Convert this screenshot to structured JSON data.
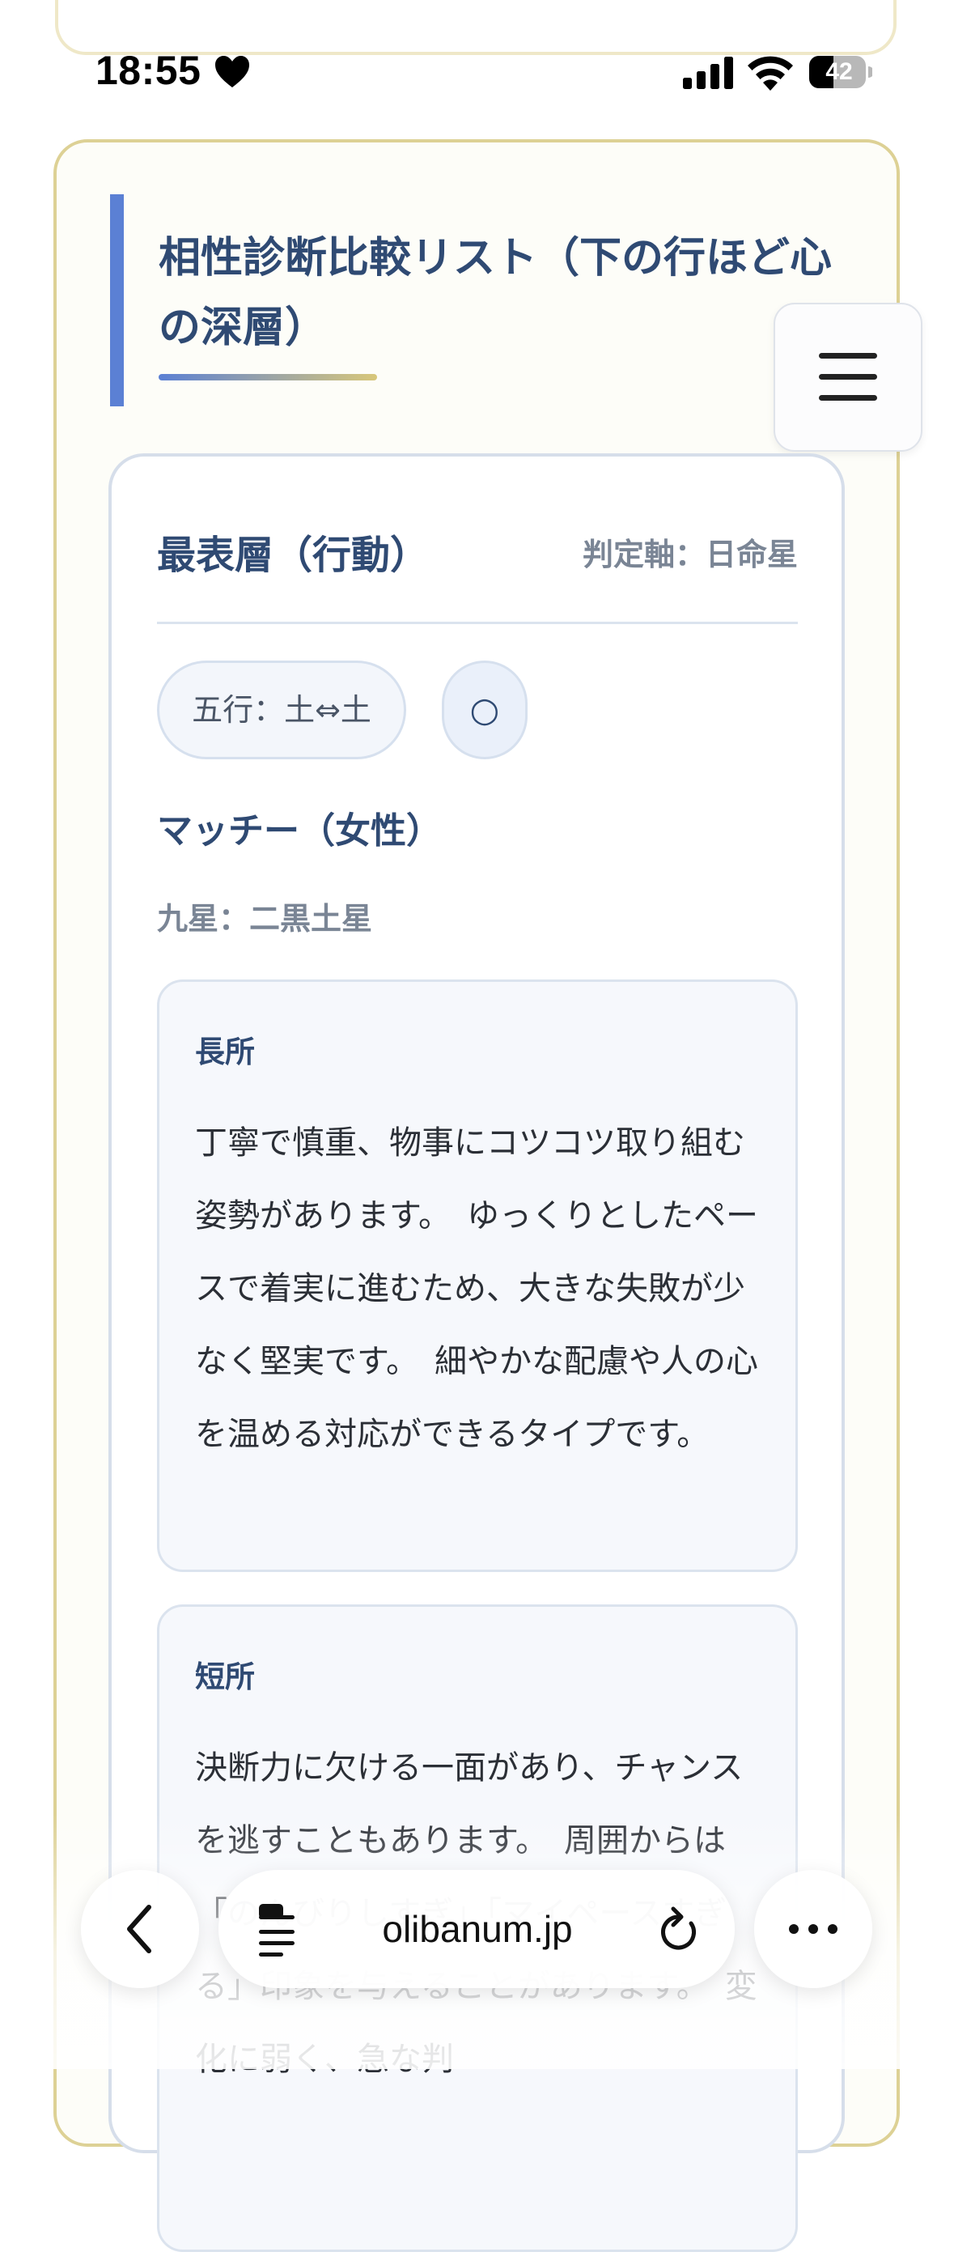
{
  "status_bar": {
    "time": "18:55",
    "battery_level": "42"
  },
  "page": {
    "title": "相性診断比較リスト（下の行ほど心の深層）"
  },
  "layer_card": {
    "title": "最表層（行動）",
    "axis_label": "判定軸：日命星",
    "element_chip": "五行：土⇔土",
    "rating": "○",
    "person_name": "マッチー（女性）",
    "nine_star": "九星：二黒土星",
    "strengths": {
      "heading": "長所",
      "text": "丁寧で慎重、物事にコツコツ取り組む姿勢があります。　ゆっくりとしたペースで着実に進むため、大きな失敗が少なく堅実です。　細やかな配慮や人の心を温める対応ができるタイプです。"
    },
    "weaknesses": {
      "heading": "短所",
      "text": "決断力に欠ける一面があり、チャンスを逃すこともあります。　周囲からは「のんびりしすぎ」「マイペースすぎる」印象を与えることがあります。　変化に弱く、急な判"
    }
  },
  "browser": {
    "url": "olibanum.jp"
  },
  "colors": {
    "accent_blue": "#5b80d4",
    "heading_navy": "#2f4a73",
    "card_border_gold": "#ddd195"
  }
}
